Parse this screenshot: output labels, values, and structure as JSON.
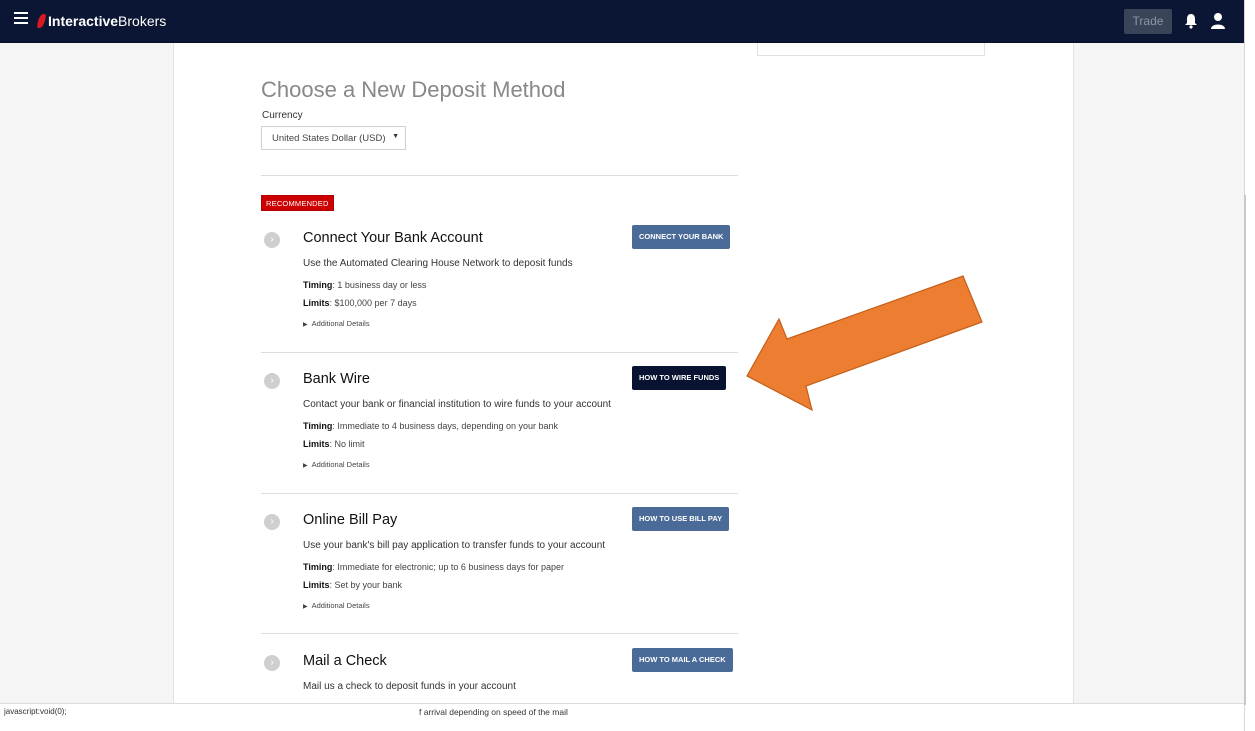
{
  "header": {
    "brand_bold": "Interactive",
    "brand_regular": "Brokers",
    "trade_label": "Trade"
  },
  "main": {
    "title": "Choose a New Deposit Method",
    "currency_label": "Currency",
    "currency_value": "United States Dollar (USD)",
    "recommended_badge": "RECOMMENDED"
  },
  "methods": [
    {
      "title": "Connect Your Bank Account",
      "description": "Use the Automated Clearing House Network to deposit funds",
      "timing_label": "Timing",
      "timing_value": ": 1 business day or less",
      "limits_label": "Limits",
      "limits_value": ": $100,000 per 7 days",
      "details": "Additional Details",
      "button": "CONNECT YOUR BANK"
    },
    {
      "title": "Bank Wire",
      "description": "Contact your bank or financial institution to wire funds to your account",
      "timing_label": "Timing",
      "timing_value": ": Immediate to 4 business days, depending on your bank",
      "limits_label": "Limits",
      "limits_value": ": No limit",
      "details": "Additional Details",
      "button": "HOW TO WIRE FUNDS"
    },
    {
      "title": "Online Bill Pay",
      "description": "Use your bank's bill pay application to transfer funds to your account",
      "timing_label": "Timing",
      "timing_value": ": Immediate for electronic; up to 6 business days for paper",
      "limits_label": "Limits",
      "limits_value": ": Set by your bank",
      "details": "Additional Details",
      "button": "HOW TO USE BILL PAY"
    },
    {
      "title": "Mail a Check",
      "description": "Mail us a check to deposit funds in your account",
      "button": "HOW TO MAIL A CHECK"
    }
  ],
  "statusbar": {
    "url": "javascript:void(0);",
    "overflow_text": "f arrival depending on speed of the mail"
  },
  "colors": {
    "topbar": "#0a1633",
    "button_blue": "#4a6b98",
    "button_dark": "#071330",
    "badge_red": "#cc0000",
    "arrow_orange": "#ed7d31"
  }
}
